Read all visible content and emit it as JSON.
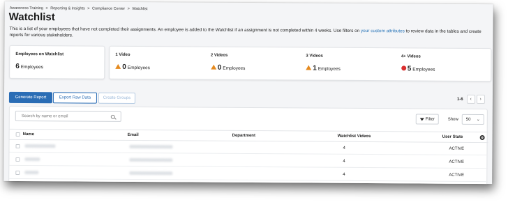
{
  "breadcrumb": [
    "Awareness Training",
    "Reporting & Insights",
    "Compliance Center",
    "Watchlist"
  ],
  "breadcrumb_separator": ">",
  "page_title": "Watchlist",
  "description": {
    "text_before": "This is a list of your employees that have not completed their assignments. An employee is added to the Watchlist if an assignment is not completed within 4 weeks. Use filters on ",
    "link": "your custom attributes",
    "text_after": " to review data in the tables and create reports for various stakeholders."
  },
  "stats": {
    "main": {
      "label": "Employees on Watchlist",
      "value": "6",
      "unit": "Employees"
    },
    "groups": [
      {
        "label": "1 Video",
        "value": "0",
        "unit": "Employees",
        "icon": "warning-icon"
      },
      {
        "label": "2 Videos",
        "value": "0",
        "unit": "Employees",
        "icon": "warning-icon"
      },
      {
        "label": "3 Videos",
        "value": "1",
        "unit": "Employees",
        "icon": "warning-icon"
      },
      {
        "label": "4+ Videos",
        "value": "5",
        "unit": "Employees",
        "icon": "error-icon"
      }
    ]
  },
  "actions": {
    "generate_report": "Generate Report",
    "export_raw_data": "Export Raw Data",
    "create_groups": "Create Groups"
  },
  "pagination": {
    "range": "1-6",
    "prev": "‹",
    "next": "›"
  },
  "table": {
    "search_placeholder": "Search by name or email",
    "filter_label": "Filter",
    "show_label": "Show",
    "show_value": "50",
    "columns": [
      "Name",
      "Email",
      "Department",
      "Watchlist Videos",
      "User State"
    ],
    "rows": [
      {
        "name": "",
        "email": "",
        "department": "",
        "videos": "4",
        "state": "ACTIVE"
      },
      {
        "name": "",
        "email": "",
        "department": "",
        "videos": "4",
        "state": "ACTIVE"
      },
      {
        "name": "",
        "email": "",
        "department": "",
        "videos": "4",
        "state": "ACTIVE"
      }
    ]
  },
  "colors": {
    "primary": "#2a6db5",
    "warning": "#e58a1f",
    "error": "#d92e2e",
    "link": "#1f6fb5"
  }
}
